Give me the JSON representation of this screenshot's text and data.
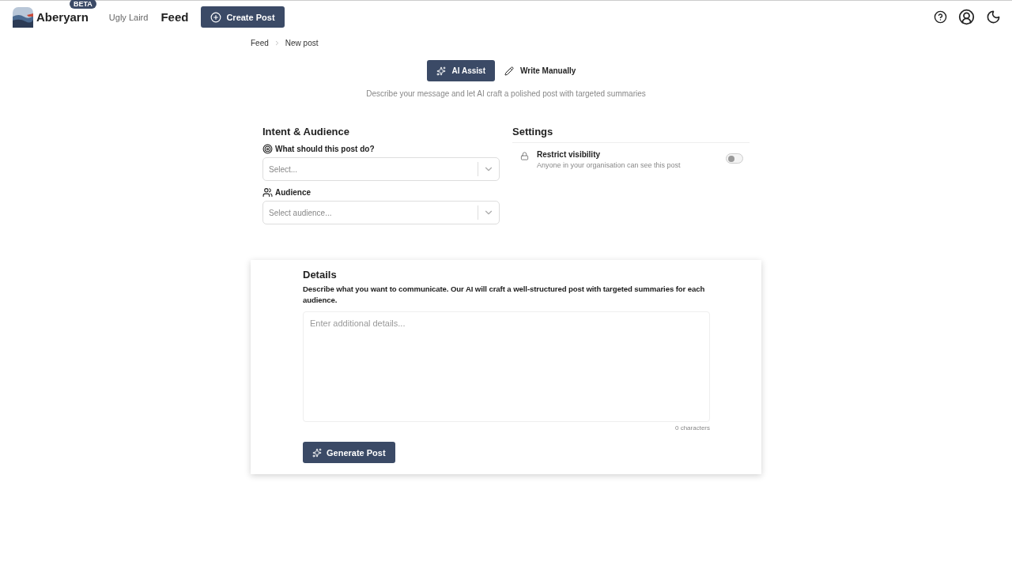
{
  "header": {
    "app_name": "Aberyarn",
    "badge": "BETA",
    "user": "Ugly Laird",
    "page_title": "Feed",
    "create_button": "Create Post"
  },
  "breadcrumb": [
    "Feed",
    "New post"
  ],
  "mode_tabs": [
    {
      "label": "AI Assist",
      "kind": "ai",
      "selected": true
    },
    {
      "label": "Write Manually",
      "kind": "manual",
      "selected": false
    }
  ],
  "subtitle": "Describe your message and let AI craft a polished post with targeted summaries",
  "intent": {
    "title": "Intent & Audience",
    "fields": [
      {
        "label": "What should this post do?",
        "kind": "target",
        "placeholder": "Select..."
      },
      {
        "label": "Audience",
        "kind": "people",
        "placeholder": "Select audience..."
      }
    ]
  },
  "settings": {
    "title": "Settings",
    "items": [
      {
        "label": "Restrict visibility",
        "description": "Anyone in your organisation can see this post",
        "on": false
      }
    ]
  },
  "details": {
    "title": "Details",
    "description": "Describe what you want to communicate. Our AI will craft a well-structured post with targeted summaries for each audience.",
    "placeholder": "Enter additional details...",
    "counter": "0 characters",
    "button": "Generate Post"
  }
}
